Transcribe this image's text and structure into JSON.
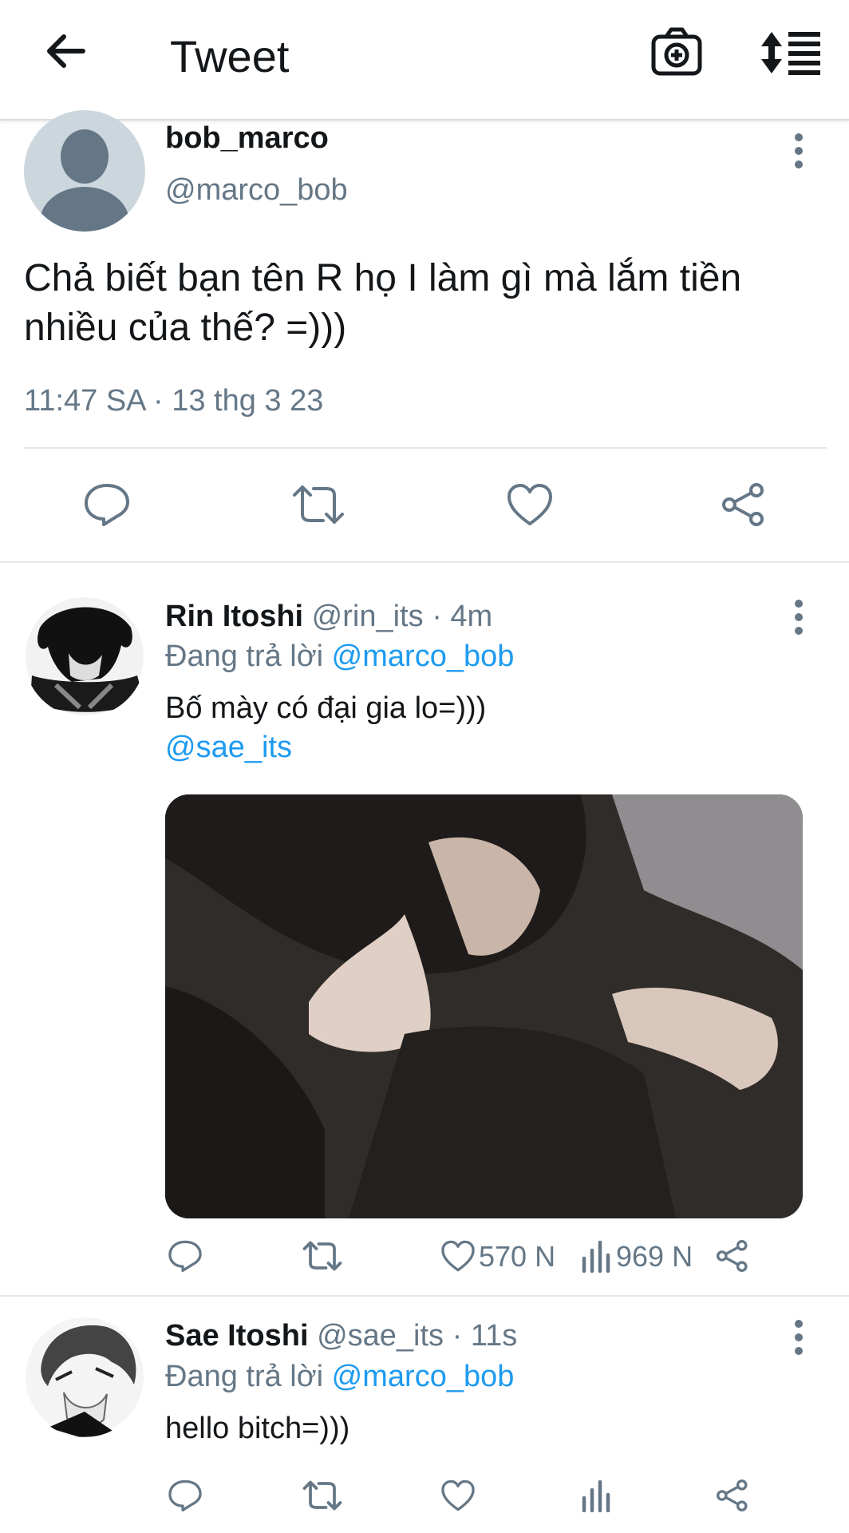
{
  "header": {
    "title": "Tweet"
  },
  "main_tweet": {
    "display_name": "bob_marco",
    "handle": "@marco_bob",
    "text_line1": "Chả biết bạn tên R họ I làm gì mà lắm tiền",
    "text_line2": "nhiều của thế? =)))",
    "timestamp": "11:47 SA · 13 thg 3 23"
  },
  "replies": [
    {
      "display_name": "Rin Itoshi",
      "handle": "@rin_its",
      "age": "· 4m",
      "replying_prefix": "Đang trả lời",
      "replying_to": "@marco_bob",
      "text": "Bố mày có đại gia lo=)))",
      "mention": "@sae_its",
      "likes": "570 N",
      "views": "969 N"
    },
    {
      "display_name": "Sae Itoshi",
      "handle": "@sae_its",
      "age": "· 11s",
      "replying_prefix": "Đang trả lời",
      "replying_to": "@marco_bob",
      "text": "hello bitch=)))"
    }
  ],
  "colors": {
    "link": "#1d9bf0",
    "muted": "#657786",
    "icon": "#1d9bf0"
  },
  "icons": [
    "back-arrow-icon",
    "camera-plus-icon",
    "sort-icon",
    "more-vertical-icon",
    "reply-icon",
    "retweet-icon",
    "like-icon",
    "share-icon",
    "views-icon"
  ]
}
